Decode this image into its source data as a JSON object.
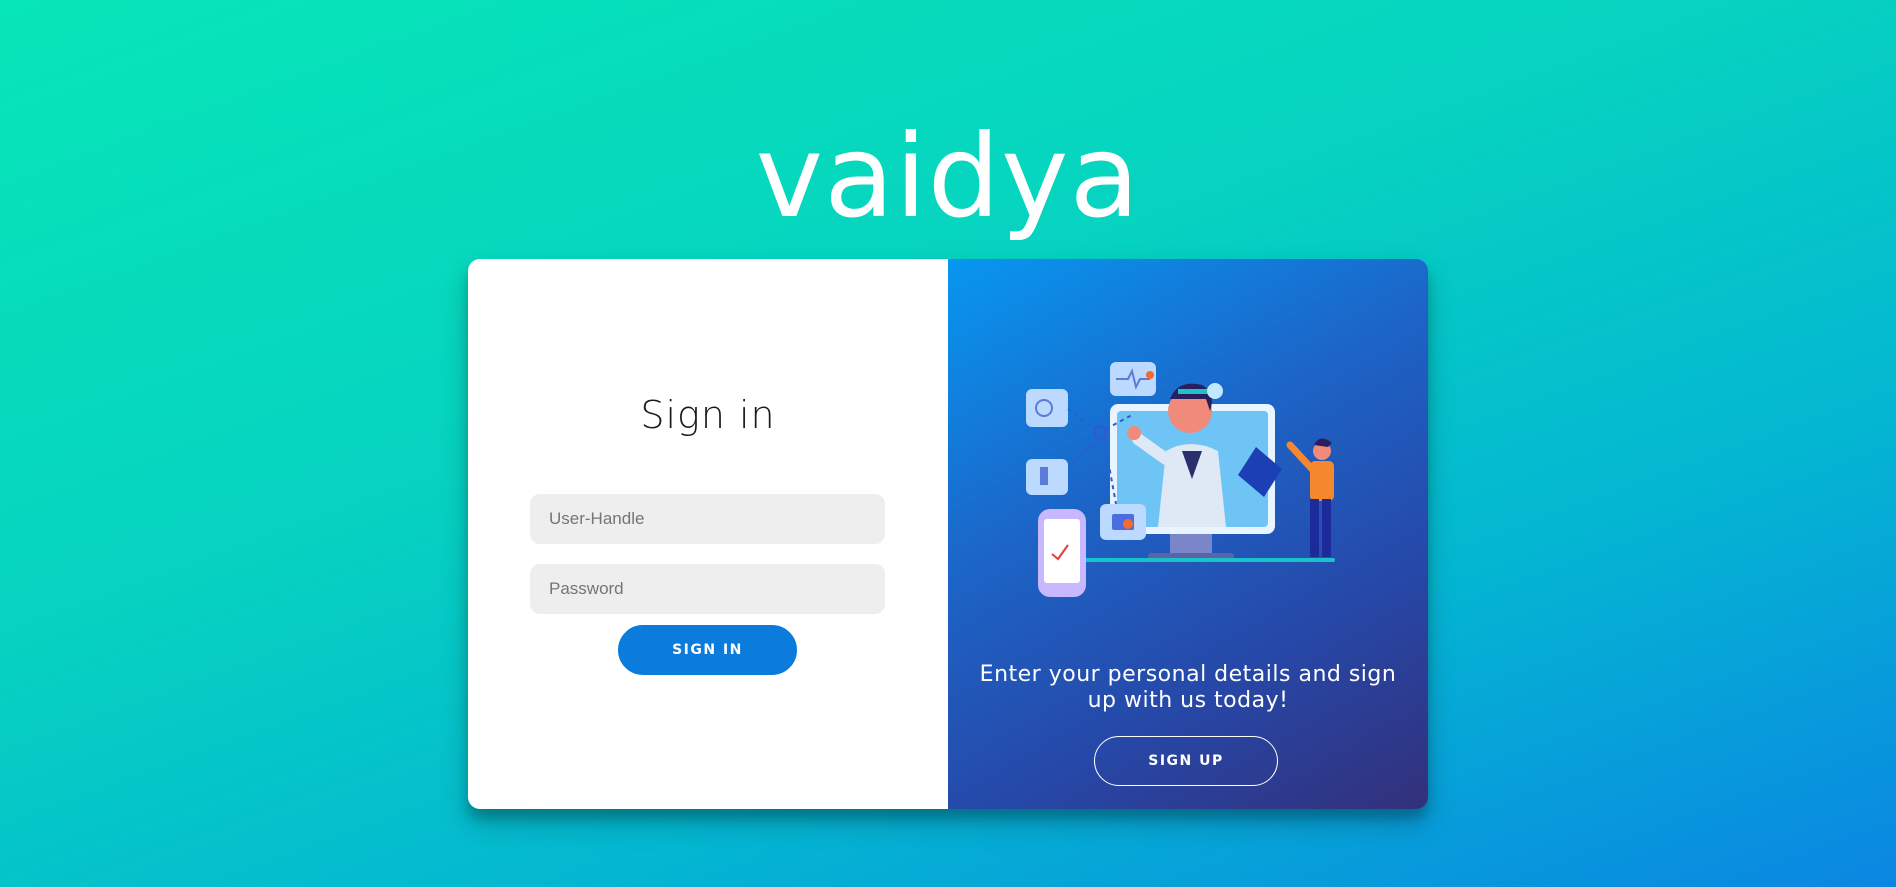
{
  "brand": {
    "title": "vaidya"
  },
  "signin": {
    "title": "Sign in",
    "user_placeholder": "User-Handle",
    "password_placeholder": "Password",
    "button_label": "SIGN IN"
  },
  "signup_panel": {
    "message": "Enter your personal details and sign up with us today!",
    "button_label": "SIGN UP",
    "illustration": "doctor-telemedicine-illustration"
  },
  "colors": {
    "primary_button": "#0b7bdc",
    "background_start": "#07e6b8",
    "background_end": "#0a86e2",
    "panel_start": "#0797f0",
    "panel_end": "#33307a"
  }
}
